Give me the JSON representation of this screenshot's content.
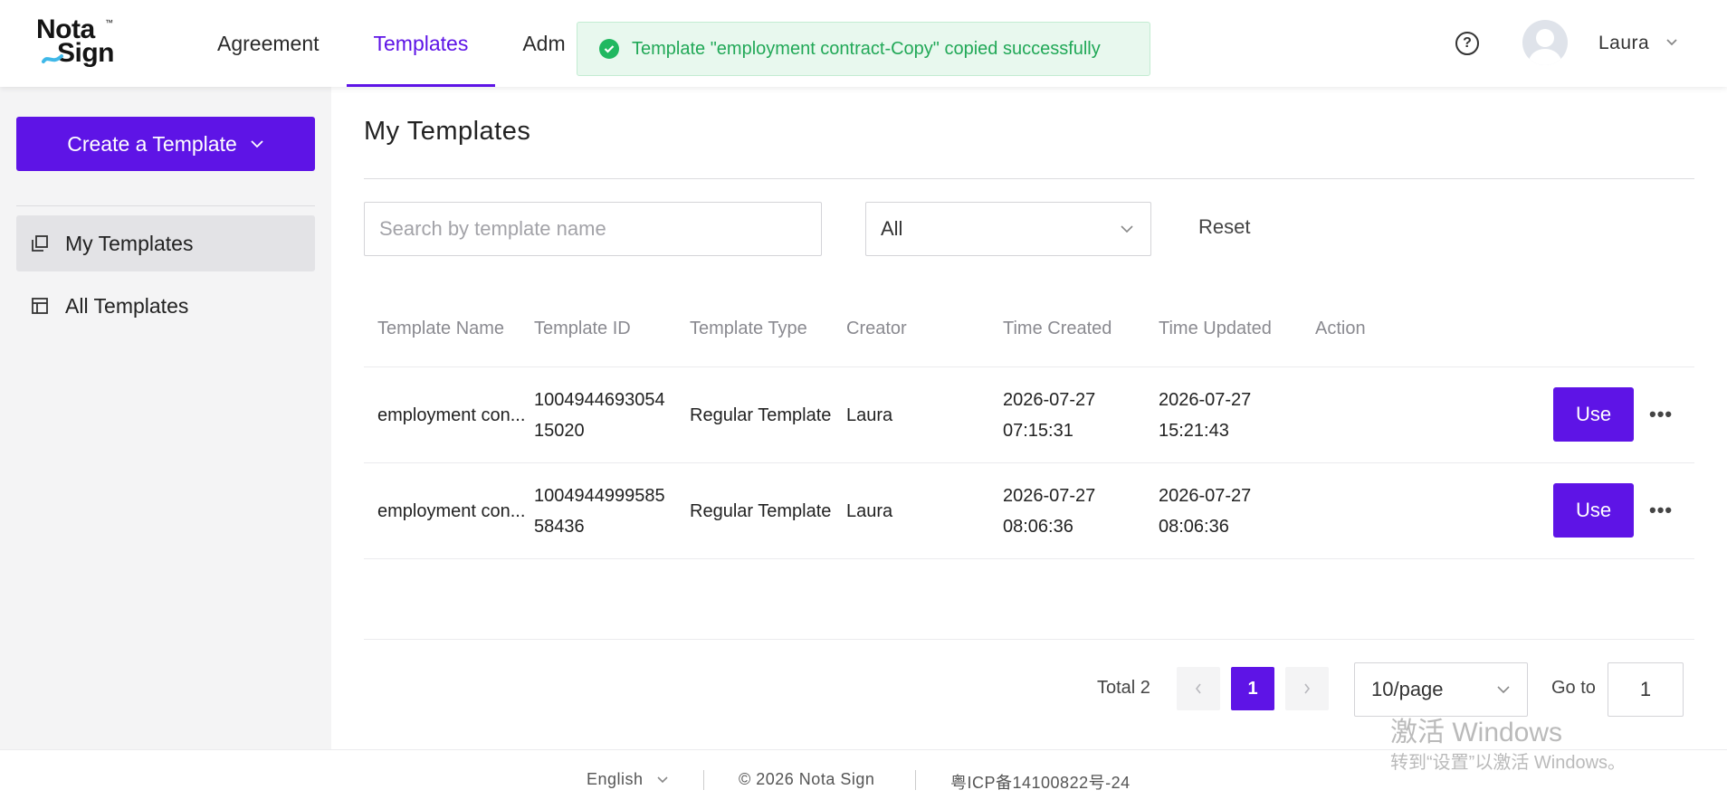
{
  "brand": {
    "logo_line1": "Nota",
    "logo_line2": "Sign",
    "trademark": "™"
  },
  "nav": {
    "items": [
      {
        "label": "Agreement",
        "active": false
      },
      {
        "label": "Templates",
        "active": true
      },
      {
        "label": "Adm",
        "active": false
      }
    ]
  },
  "toast": {
    "message": "Template \"employment contract-Copy\" copied successfully",
    "type": "success",
    "icon": "check-circle-icon"
  },
  "header": {
    "help_icon": "question-circle-icon",
    "help_glyph": "?",
    "user_name": "Laura"
  },
  "sidebar": {
    "create_button": "Create a Template",
    "items": [
      {
        "label": "My Templates",
        "icon": "copy-icon",
        "active": true
      },
      {
        "label": "All Templates",
        "icon": "layout-icon",
        "active": false
      }
    ]
  },
  "main": {
    "title": "My Templates",
    "search_placeholder": "Search by template name",
    "filter_value": "All",
    "reset_label": "Reset"
  },
  "table": {
    "columns": [
      "Template Name",
      "Template ID",
      "Template Type",
      "Creator",
      "Time Created",
      "Time Updated",
      "Action"
    ],
    "rows": [
      {
        "name": "employment con...",
        "id_line1": "1004944693054",
        "id_line2": "15020",
        "type": "Regular Template",
        "creator": "Laura",
        "created_date": "2026-07-27",
        "created_time": "07:15:31",
        "updated_date": "2026-07-27",
        "updated_time": "15:21:43",
        "action": "Use",
        "more": "•••"
      },
      {
        "name": "employment con...",
        "id_line1": "1004944999585",
        "id_line2": "58436",
        "type": "Regular Template",
        "creator": "Laura",
        "created_date": "2026-07-27",
        "created_time": "08:06:36",
        "updated_date": "2026-07-27",
        "updated_time": "08:06:36",
        "action": "Use",
        "more": "•••"
      }
    ]
  },
  "pagination": {
    "total": "Total 2",
    "prev": "‹",
    "current_page": "1",
    "next": "›",
    "page_size": "10/page",
    "goto_label": "Go to",
    "goto_value": "1"
  },
  "footer": {
    "language": "English",
    "copyright": "© 2026 Nota Sign",
    "icp": "粤ICP备14100822号-24"
  },
  "watermark": {
    "line1": "激活 Windows",
    "line2": "转到“设置”以激活 Windows。"
  },
  "colors": {
    "accent": "#5e14e6",
    "success": "#21a857",
    "sidebar_bg": "#f4f4f5"
  }
}
